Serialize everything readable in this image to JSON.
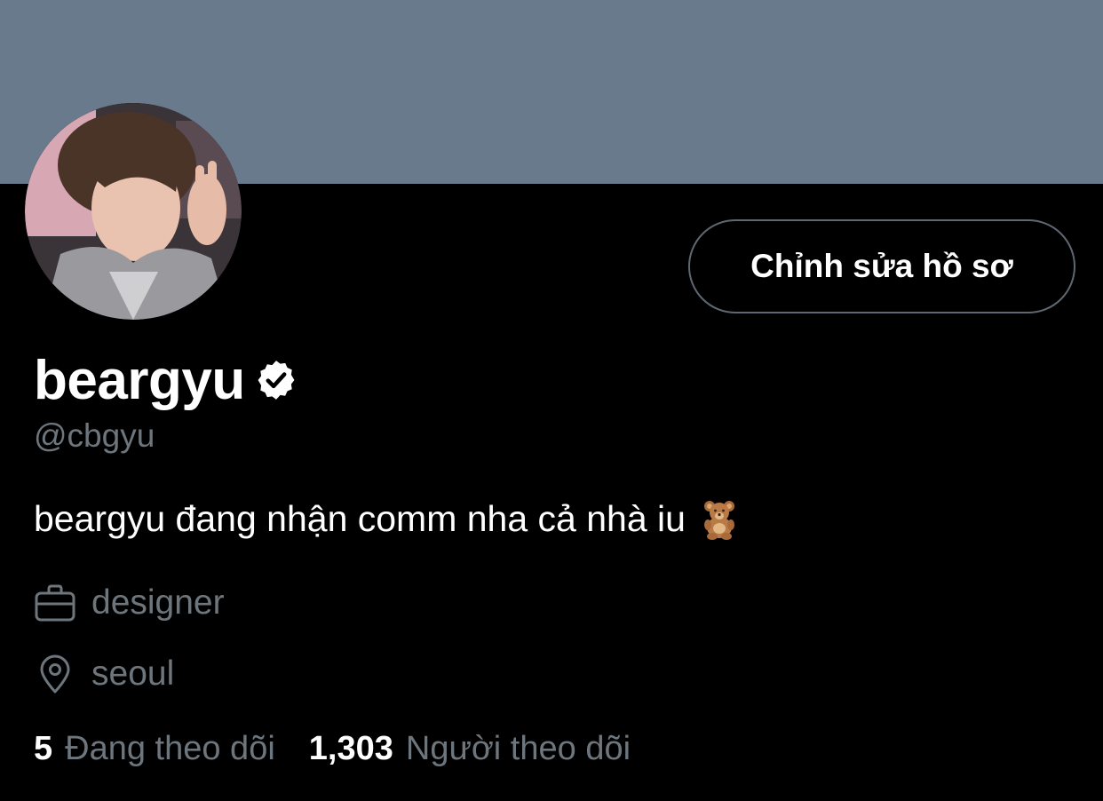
{
  "colors": {
    "banner": "#687a8b",
    "background": "#000000",
    "primary_text": "#ffffff",
    "secondary_text": "#6e767d",
    "button_border": "#5f6872"
  },
  "profile": {
    "display_name": "beargyu",
    "verified_icon": "verified-badge-icon",
    "handle": "@cbgyu",
    "bio": "beargyu đang nhận comm nha cả nhà iu",
    "bio_emoji": "teddy-bear-icon",
    "edit_button_label": "Chỉnh sửa hồ sơ"
  },
  "meta": {
    "job_icon": "briefcase-icon",
    "job": "designer",
    "location_icon": "location-pin-icon",
    "location": "seoul"
  },
  "follow": {
    "following_count": "5",
    "following_label": "Đang theo dõi",
    "followers_count": "1,303",
    "followers_label": "Người theo dõi"
  }
}
